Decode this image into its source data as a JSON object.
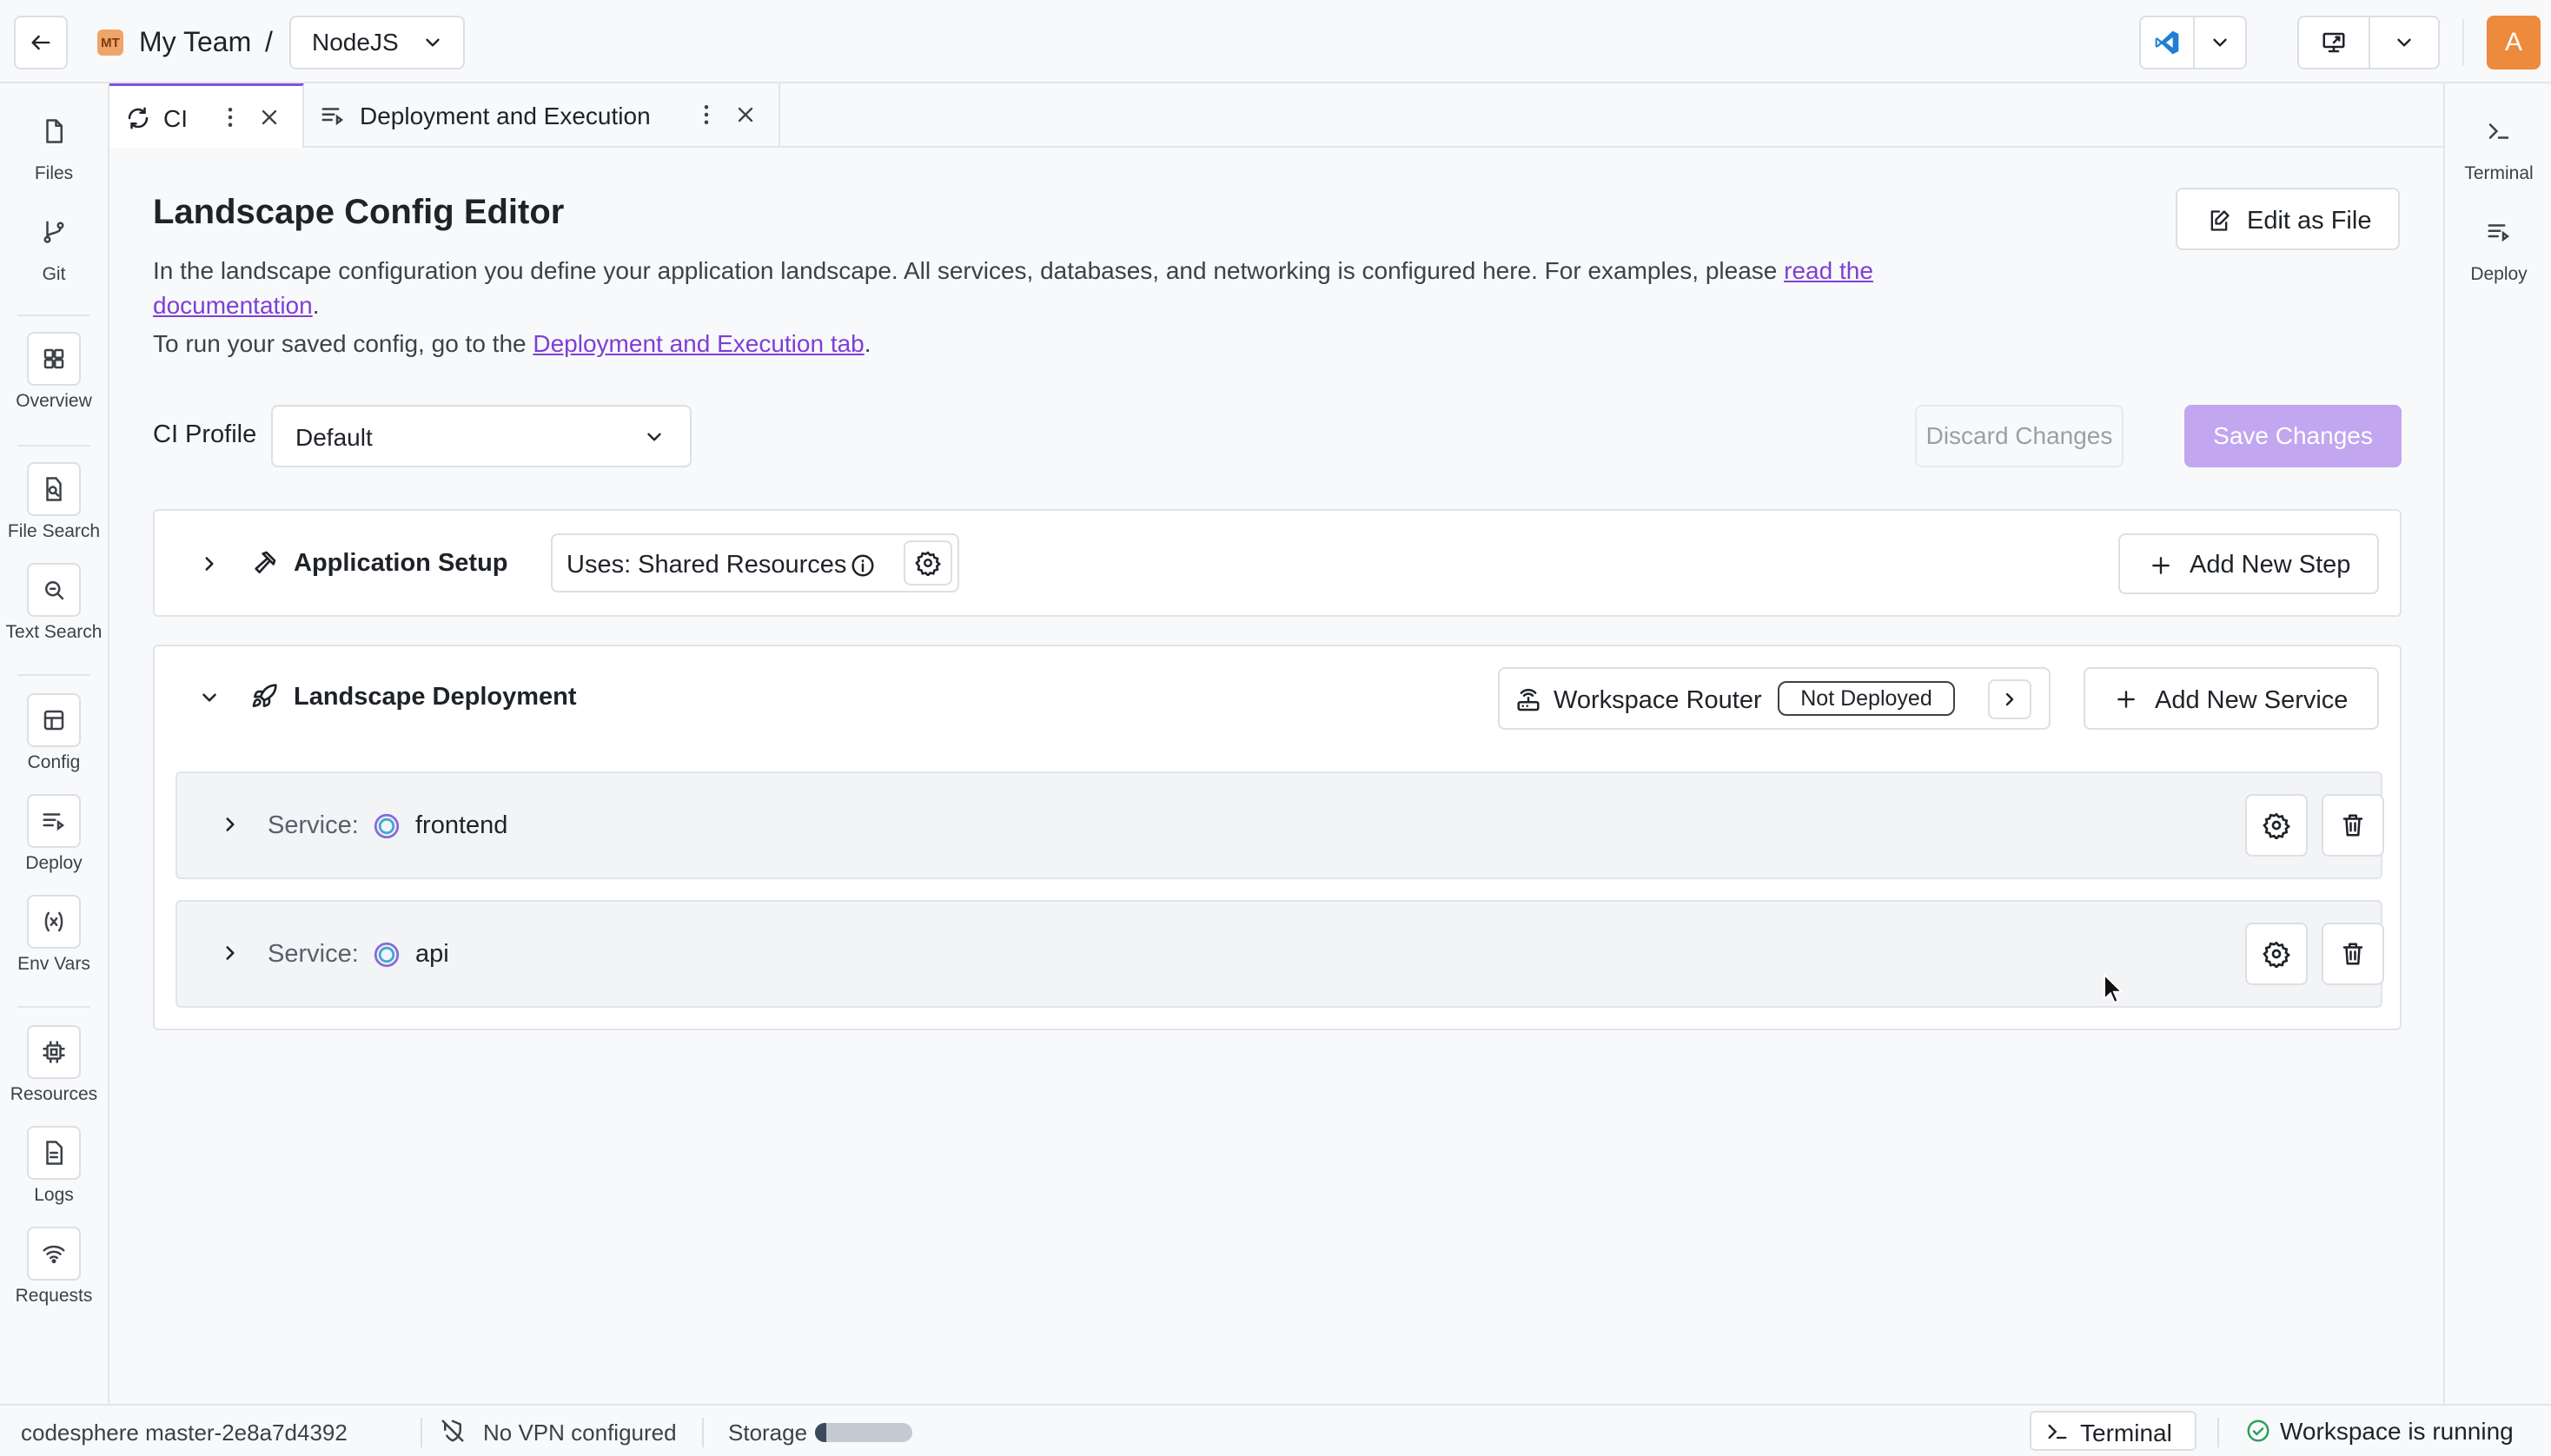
{
  "topbar": {
    "team_initials": "MT",
    "team_name": "My Team",
    "separator": "/",
    "workspace": "NodeJS",
    "user_initial": "A"
  },
  "leftbar": {
    "items": [
      {
        "label": "Files",
        "icon": "file-icon"
      },
      {
        "label": "Git",
        "icon": "git-branch-icon"
      },
      {
        "label": "Overview",
        "icon": "grid-icon"
      },
      {
        "label": "File Search",
        "icon": "file-search-icon"
      },
      {
        "label": "Text Search",
        "icon": "text-search-icon"
      },
      {
        "label": "Config",
        "icon": "config-icon"
      },
      {
        "label": "Deploy",
        "icon": "deploy-icon"
      },
      {
        "label": "Env Vars",
        "icon": "variable-icon"
      },
      {
        "label": "Resources",
        "icon": "chip-icon"
      },
      {
        "label": "Logs",
        "icon": "log-icon"
      },
      {
        "label": "Requests",
        "icon": "wifi-icon"
      }
    ]
  },
  "rightbar": {
    "items": [
      {
        "label": "Terminal",
        "icon": "terminal-icon"
      },
      {
        "label": "Deploy",
        "icon": "deploy-icon"
      }
    ]
  },
  "tabs": [
    {
      "label": "CI",
      "icon": "ci-icon",
      "active": true
    },
    {
      "label": "Deployment and Execution",
      "icon": "deploy-icon",
      "active": false
    }
  ],
  "editor": {
    "title": "Landscape Config Editor",
    "edit_as_file": "Edit as File",
    "desc_text": "In the landscape configuration you define your application landscape. All services, databases, and networking is configured here. For examples, please ",
    "desc_link": "read the documentation",
    "desc_end": ".",
    "run_text": "To run your saved config, go to the ",
    "run_link": "Deployment and Execution tab",
    "run_end": ".",
    "ci_profile_label": "CI Profile",
    "ci_profile_value": "Default",
    "discard": "Discard Changes",
    "save": "Save Changes"
  },
  "setup": {
    "title": "Application Setup",
    "uses_label": "Uses: Shared Resources",
    "add_step": "Add New Step"
  },
  "deployment": {
    "title": "Landscape Deployment",
    "router_label": "Workspace Router",
    "router_status": "Not Deployed",
    "add_service": "Add New Service",
    "service_prefix": "Service:",
    "services": [
      {
        "name": "frontend"
      },
      {
        "name": "api"
      }
    ]
  },
  "statusbar": {
    "branch": "codesphere master-2e8a7d4392",
    "vpn": "No VPN configured",
    "storage_label": "Storage",
    "storage_fraction": 0.12,
    "terminal": "Terminal",
    "workspace_status": "Workspace is running"
  },
  "colors": {
    "accent": "#7e53d9",
    "link": "#7e3fd6",
    "save_disabled": "#c2a6f0",
    "avatar": "#ee8a3c",
    "running": "#2f9e5a"
  }
}
